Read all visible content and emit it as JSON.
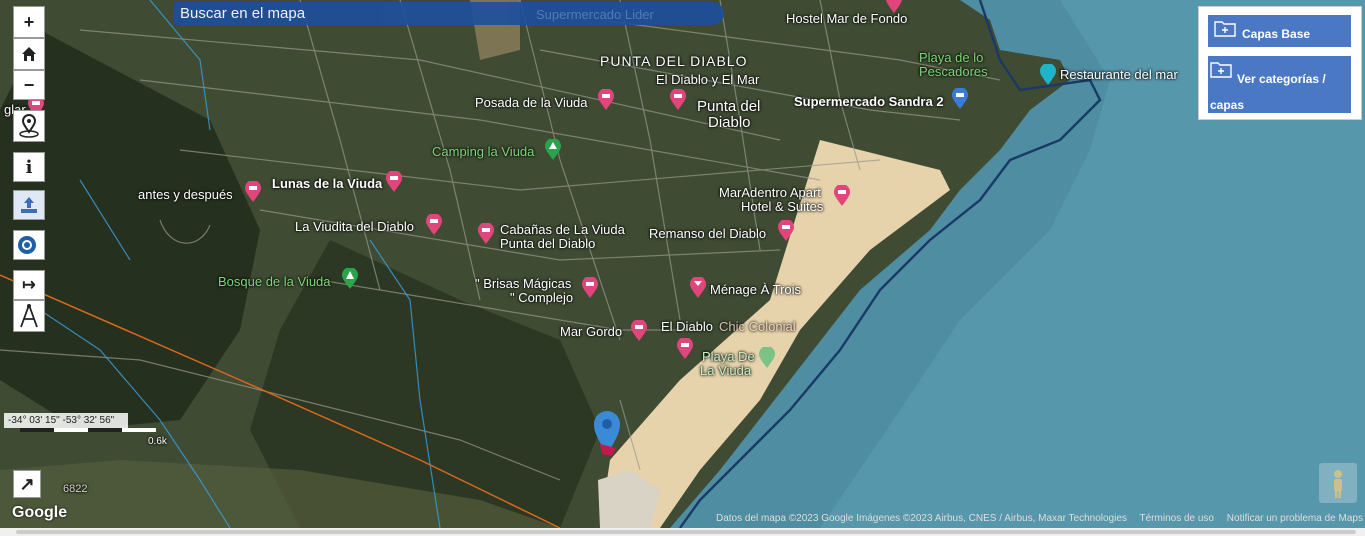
{
  "search": {
    "label": "Buscar en el mapa",
    "ghost": "Supermercado Lider"
  },
  "controls": {
    "zoom_in": "+",
    "zoom_out": "−",
    "info": "i",
    "measure": "↦",
    "fullscreen": "↗"
  },
  "layers_panel": {
    "base_label": "Capas Base",
    "categories_label": "Ver categorías / capas"
  },
  "coordinates": "-34° 03' 15\" -53° 32' 56\"",
  "scale": "0.6k",
  "road_number": "6822",
  "google": "Google",
  "attribution": {
    "data": "Datos del mapa ©2023 Google Imágenes ©2023 Airbus, CNES / Airbus, Maxar Technologies",
    "terms": "Términos de uso",
    "report": "Notificar un problema de Maps"
  },
  "places": {
    "hostel": "Hostel Mar de Fondo",
    "playa_pescadores_1": "Playa de lo",
    "playa_pescadores_2": "Pescadores",
    "restaurante": "Restaurante del mar",
    "punta_caps": "PUNTA DEL DIABLO",
    "el_diablo_mar": "El Diablo y El Mar",
    "posada": "Posada de la Viuda",
    "punta_1": "Punta del",
    "punta_2": "Diablo",
    "supermercado": "Supermercado Sandra 2",
    "camping": "Camping la Viuda",
    "lunas": "Lunas de la Viuda",
    "antes": "antes y después",
    "viudita": "La Viudita del Diablo",
    "cabanas_1": "Cabañas de La Viuda",
    "cabanas_2": "Punta del Diablo",
    "maradentro_1": "MarAdentro Apart",
    "maradentro_2": "Hotel & Suites",
    "remanso": "Remanso del Diablo",
    "bosque": "Bosque de la Viuda",
    "brisas_1": "\" Brisas Mágicas",
    "brisas_2": "\" Complejo",
    "menage": "Ménage À Trois",
    "mar_gordo": "Mar Gordo",
    "el_diablo": "El Diablo",
    "chic": "Chic Colonial",
    "playa_viuda_1": "Playa De",
    "playa_viuda_2": "La Viuda",
    "left_cut": "glar"
  },
  "colors": {
    "ocean": "#4f8da3",
    "sand": "#e6d2ab",
    "land": "#3f4b33",
    "forest": "#26301f",
    "pin_pink": "#e0457b",
    "pin_blue": "#3b7bd8",
    "marker_blue": "#3a8ad6",
    "panel_blue": "#4a78c4",
    "search_blue": "#1e4f9c"
  }
}
